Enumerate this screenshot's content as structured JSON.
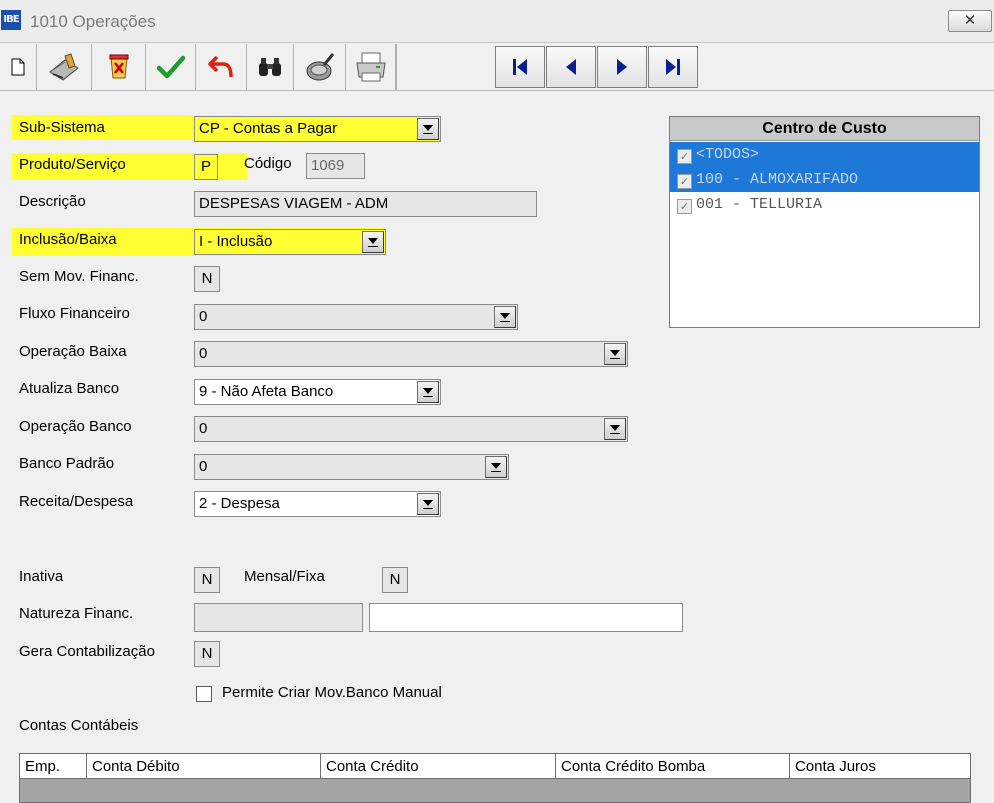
{
  "window": {
    "icon_text": "IBE",
    "title": "1010 Operações",
    "close_symbol": "✕"
  },
  "toolbar": {
    "buttons": [
      "new-icon",
      "edit-icon",
      "delete-icon",
      "confirm-icon",
      "undo-icon",
      "search-icon",
      "clear-icon",
      "print-icon"
    ],
    "nav": [
      "first-record-icon",
      "previous-record-icon",
      "next-record-icon",
      "last-record-icon"
    ]
  },
  "form": {
    "sub_sistema": {
      "label": "Sub-Sistema",
      "value": "CP - Contas a Pagar"
    },
    "produto_servico": {
      "label": "Produto/Serviço",
      "value": "P"
    },
    "codigo": {
      "label": "Código",
      "value": "1069"
    },
    "descricao": {
      "label": "Descrição",
      "value": "DESPESAS VIAGEM - ADM"
    },
    "inclusao_baixa": {
      "label": "Inclusão/Baixa",
      "value": "I - Inclusão"
    },
    "sem_mov_financ": {
      "label": "Sem Mov. Financ.",
      "value": "N"
    },
    "fluxo_financeiro": {
      "label": "Fluxo Financeiro",
      "value": "0"
    },
    "operacao_baixa": {
      "label": "Operação Baixa",
      "value": "0"
    },
    "atualiza_banco": {
      "label": "Atualiza Banco",
      "value": "9 - Não Afeta Banco"
    },
    "operacao_banco": {
      "label": "Operação Banco",
      "value": "0"
    },
    "banco_padrao": {
      "label": "Banco Padrão",
      "value": "0"
    },
    "receita_despesa": {
      "label": "Receita/Despesa",
      "value": "2 - Despesa"
    },
    "inativa": {
      "label": "Inativa",
      "value": "N"
    },
    "mensal_fixa": {
      "label": "Mensal/Fixa",
      "value": "N"
    },
    "natureza_financ": {
      "label": "Natureza Financ.",
      "code": "",
      "desc": ""
    },
    "gera_contabilizacao": {
      "label": "Gera Contabilização",
      "value": "N"
    },
    "permite_criar": {
      "label": "Permite Criar Mov.Banco Manual",
      "checked": false
    },
    "contas_contabeis": {
      "label": "Contas Contábeis"
    }
  },
  "centro_custo": {
    "title": "Centro de Custo",
    "items": [
      {
        "label": "<TODOS>",
        "checked": true,
        "selected": true
      },
      {
        "label": "100 - ALMOXARIFADO",
        "checked": true,
        "selected": true
      },
      {
        "label": "001 - TELLURIA",
        "checked": true,
        "selected": false
      }
    ]
  },
  "grid": {
    "columns": [
      "Emp.",
      "Conta Débito",
      "Conta Crédito",
      "Conta Crédito Bomba",
      "Conta Juros"
    ]
  },
  "colors": {
    "highlight": "#ffff33",
    "selection": "#1e78d8"
  }
}
